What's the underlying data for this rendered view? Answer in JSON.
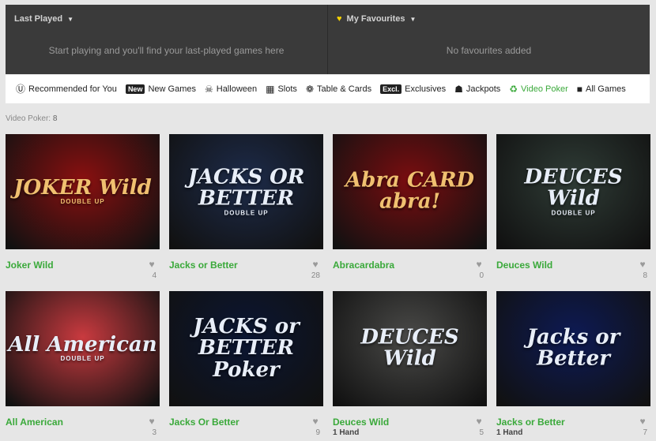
{
  "last_played": {
    "label": "Last Played",
    "message": "Start playing and you'll find your last-played games here"
  },
  "favourites": {
    "label": "My Favourites",
    "message": "No favourites added"
  },
  "categories": [
    {
      "label": "Recommended for You",
      "icon": "recommended-icon",
      "badge": ""
    },
    {
      "label": "New Games",
      "icon": "new-badge-icon",
      "badge": "New"
    },
    {
      "label": "Halloween",
      "icon": "halloween-icon",
      "badge": ""
    },
    {
      "label": "Slots",
      "icon": "slots-icon",
      "badge": ""
    },
    {
      "label": "Table & Cards",
      "icon": "chip-icon",
      "badge": ""
    },
    {
      "label": "Exclusives",
      "icon": "exclusive-badge-icon",
      "badge": "Excl."
    },
    {
      "label": "Jackpots",
      "icon": "pot-icon",
      "badge": ""
    },
    {
      "label": "Video Poker",
      "icon": "video-poker-icon",
      "badge": "",
      "active": true
    },
    {
      "label": "All Games",
      "icon": "all-games-icon",
      "badge": ""
    }
  ],
  "listing": {
    "prefix": "Video Poker:",
    "count": "8"
  },
  "games": [
    {
      "title": "Joker Wild",
      "logo": "JOKER Wild",
      "sub": "DOUBLE UP",
      "favs": "4",
      "meta": "",
      "bg": "#8a1010"
    },
    {
      "title": "Jacks or Better",
      "logo": "JACKS OR BETTER",
      "sub": "DOUBLE UP",
      "favs": "28",
      "meta": "",
      "bg": "#1d2b4a"
    },
    {
      "title": "Abracardabra",
      "logo": "Abra CARD abra!",
      "sub": "",
      "favs": "0",
      "meta": "",
      "bg": "#7a0d10"
    },
    {
      "title": "Deuces Wild",
      "logo": "DEUCES Wild",
      "sub": "DOUBLE UP",
      "favs": "8",
      "meta": "",
      "bg": "#2f3c36"
    },
    {
      "title": "All American",
      "logo": "All American",
      "sub": "DOUBLE UP",
      "favs": "3",
      "meta": "",
      "bg": "#c93a3f"
    },
    {
      "title": "Jacks Or Better",
      "logo": "JACKS or BETTER Poker",
      "sub": "",
      "favs": "9",
      "meta": "",
      "bg": "#0b1633"
    },
    {
      "title": "Deuces Wild",
      "logo": "DEUCES Wild",
      "sub": "",
      "favs": "5",
      "meta": "1 Hand",
      "bg": "#4a4a48"
    },
    {
      "title": "Jacks or Better",
      "logo": "Jacks or Better",
      "sub": "",
      "favs": "7",
      "meta": "1 Hand",
      "bg": "#0d1a55"
    }
  ]
}
